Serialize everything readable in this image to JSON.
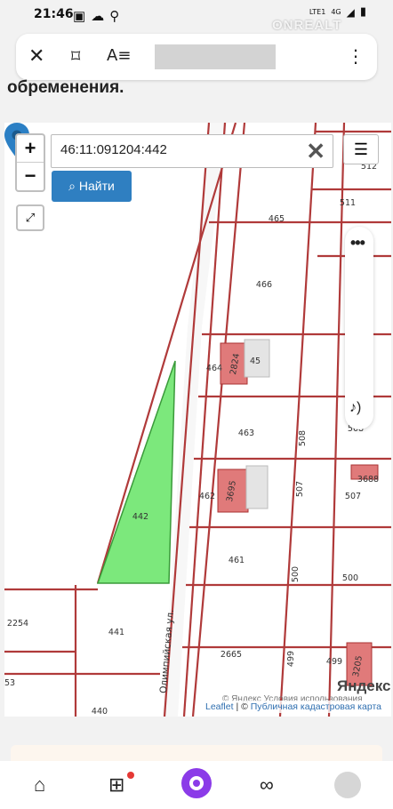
{
  "status_bar": {
    "time": "21:46",
    "network": "4G",
    "carrier": "LTE1"
  },
  "watermark": "ONREALT",
  "browser": {
    "close_icon": "close-icon",
    "bookmark_icon": "bookmark-icon",
    "reader_icon": "reader-icon",
    "menu_icon": "more-vert-icon"
  },
  "page": {
    "heading_fragment": "обременения."
  },
  "map": {
    "search_value": "46:11:091204:442",
    "find_label": "Найти",
    "zoom_in": "+",
    "zoom_out": "−",
    "parcels": [
      "442",
      "441",
      "440",
      "2254",
      "53",
      "465",
      "466",
      "464",
      "463",
      "462",
      "461",
      "2665",
      "511",
      "512",
      "508",
      "507",
      "500",
      "499",
      "2824",
      "45",
      "3695",
      "3688",
      "3205"
    ],
    "street": "Олимпийская ул.",
    "attribution_leaflet": "Leaflet",
    "attribution_sep": " | © ",
    "attribution_cadastre": "Публичная кадастровая карта",
    "yandex_copy": "© Яндекс  Условия использования",
    "yandex_logo": "Яндекс"
  },
  "colors": {
    "parcel_border": "#b03a3a",
    "selected_fill": "#7ce87c",
    "building": "#e07a7a",
    "button_blue": "#2f7fc1"
  }
}
